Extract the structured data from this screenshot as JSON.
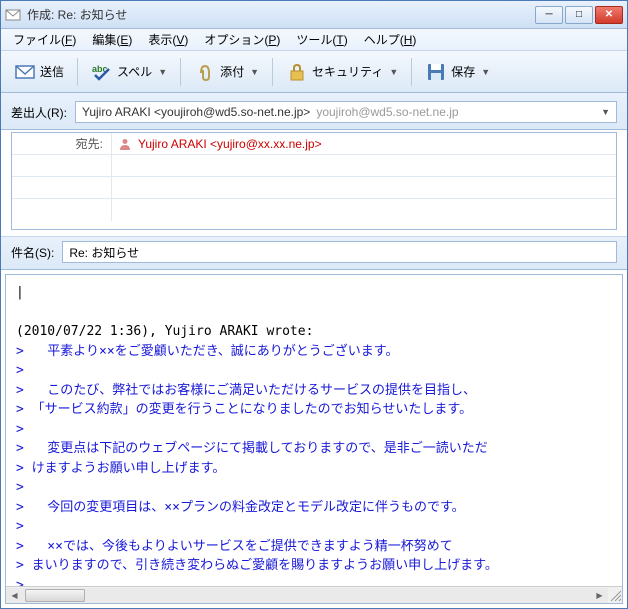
{
  "window": {
    "title": "作成: Re: お知らせ"
  },
  "menu": {
    "file": "ファイル(F)",
    "edit": "編集(E)",
    "view": "表示(V)",
    "options": "オプション(P)",
    "tools": "ツール(T)",
    "help": "ヘルプ(H)"
  },
  "toolbar": {
    "send": "送信",
    "spell": "スペル",
    "attach": "添付",
    "security": "セキュリティ",
    "save": "保存"
  },
  "from": {
    "label": "差出人(R):",
    "main": "Yujiro ARAKI <youjiroh@wd5.so-net.ne.jp>",
    "sub": "youjiroh@wd5.so-net.ne.jp"
  },
  "recipient": {
    "type_label": "宛先:",
    "address": "Yujiro ARAKI <yujiro@xx.xx.ne.jp>"
  },
  "subject": {
    "label": "件名(S):",
    "value": "Re: お知らせ"
  },
  "body": {
    "cursor": "|",
    "attribution": "(2010/07/22 1:36), Yujiro ARAKI wrote:",
    "quoted_lines": [
      ">   平素より××をご愛顧いただき、誠にありがとうございます。",
      ">",
      ">   このたび、弊社ではお客様にご満足いただけるサービスの提供を目指し、",
      "> 「サービス約款」の変更を行うことになりましたのでお知らせいたします。",
      ">",
      ">   変更点は下記のウェブページにて掲載しておりますので、是非ご一読いただ",
      "> けますようお願い申し上げます。",
      ">",
      ">   今回の変更項目は、××プランの料金改定とモデル改定に伴うものです。",
      ">",
      ">   ××では、今後もよりよいサービスをご提供できますよう精一杯努めて",
      "> まいりますので、引き続き変わらぬご愛顧を賜りますようお願い申し上げます。",
      ">"
    ]
  }
}
